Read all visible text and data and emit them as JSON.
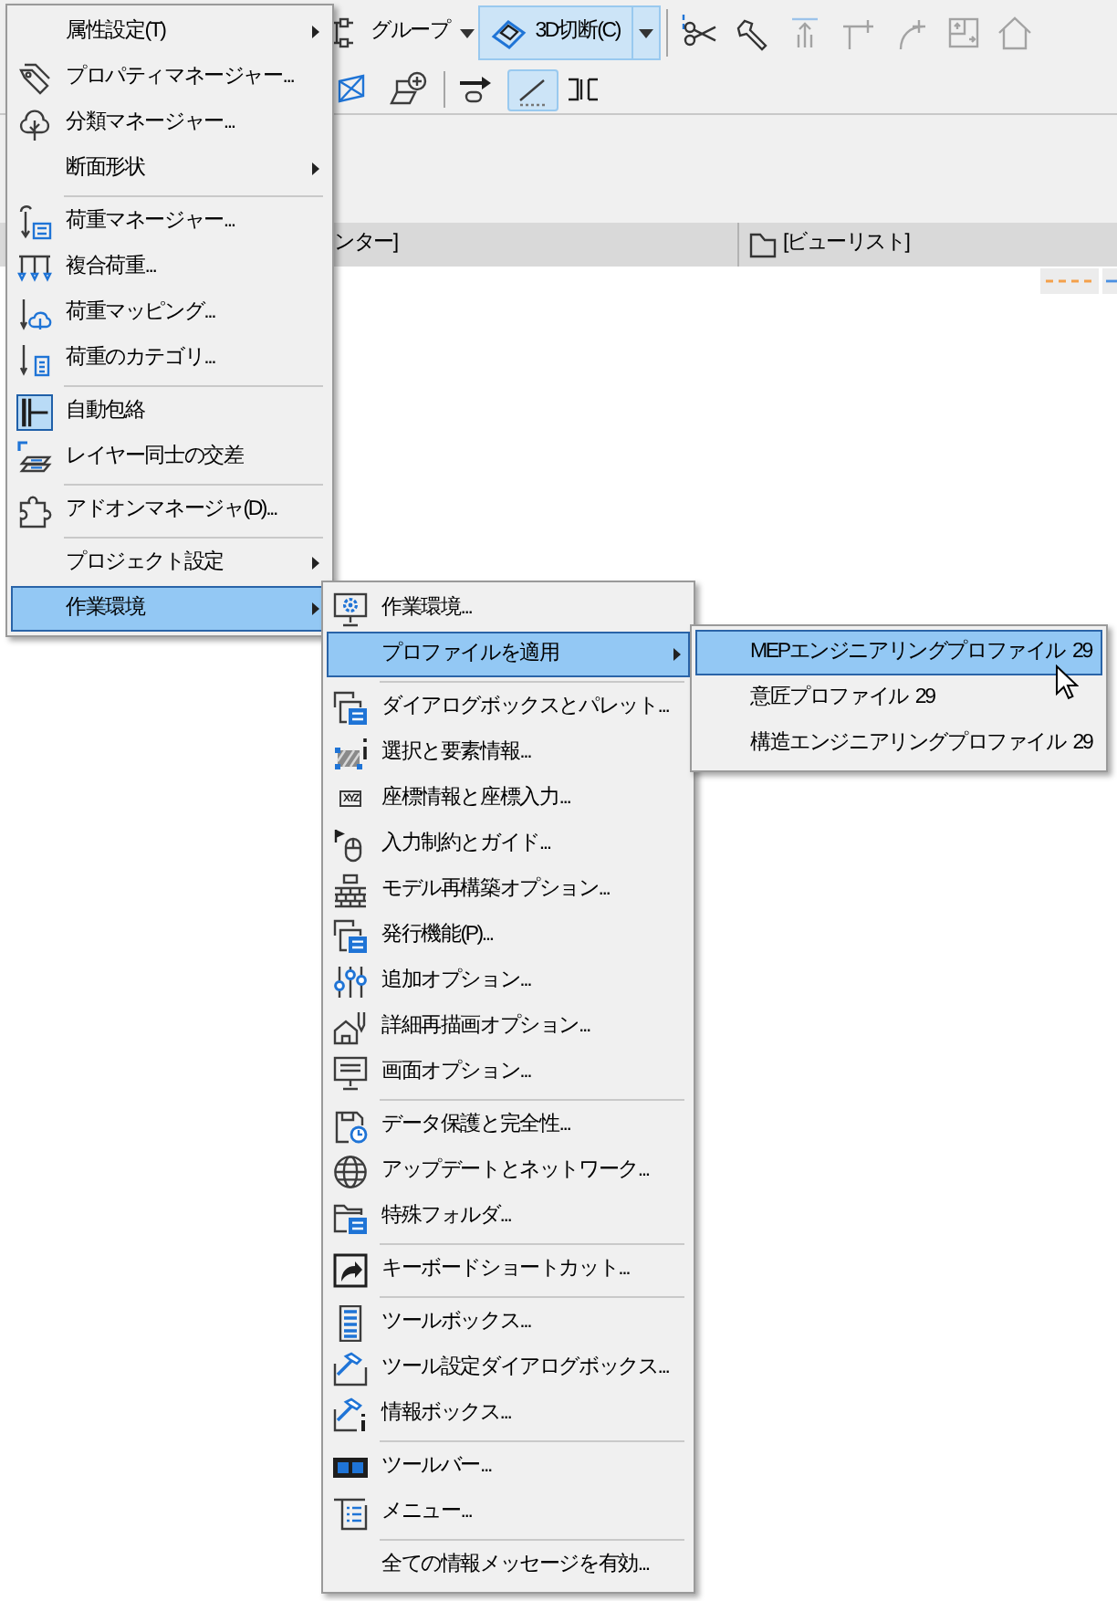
{
  "toolbar": {
    "row_1": [
      {
        "kind": "dropdown",
        "label": "グループ",
        "selected": false
      },
      {
        "kind": "split",
        "label": "3D切断(C)",
        "selected": true
      },
      {
        "kind": "separator"
      },
      {
        "kind": "icon",
        "disabled": false
      },
      {
        "kind": "icon",
        "disabled": false
      },
      {
        "kind": "icon",
        "disabled": true
      },
      {
        "kind": "icon",
        "disabled": true
      },
      {
        "kind": "icon",
        "disabled": true
      },
      {
        "kind": "icon",
        "disabled": true
      },
      {
        "kind": "icon",
        "disabled": true
      }
    ],
    "row_2": [
      {
        "kind": "icon",
        "selected": false
      },
      {
        "kind": "icon",
        "selected": false
      },
      {
        "kind": "separator"
      },
      {
        "kind": "icon",
        "selected": false
      },
      {
        "kind": "icon",
        "selected": true
      },
      {
        "kind": "icon",
        "selected": false
      }
    ]
  },
  "tab_bar": {
    "tabs": [
      {
        "label": "ンター]"
      },
      {
        "label": "[ビューリスト]"
      }
    ]
  },
  "menus": [
    {
      "items": [
        {
          "kind": "submenu",
          "label": "属性設定(T)",
          "selected": false,
          "checked": false
        },
        {
          "kind": "command",
          "label": "プロパティマネージャー...",
          "selected": false,
          "checked": false
        },
        {
          "kind": "command",
          "label": "分類マネージャー...",
          "selected": false,
          "checked": false
        },
        {
          "kind": "submenu",
          "label": "断面形状",
          "selected": false,
          "checked": false
        },
        {
          "kind": "separator"
        },
        {
          "kind": "command",
          "label": "荷重マネージャー...",
          "selected": false,
          "checked": false
        },
        {
          "kind": "command",
          "label": "複合荷重...",
          "selected": false,
          "checked": false
        },
        {
          "kind": "command",
          "label": "荷重マッピング...",
          "selected": false,
          "checked": false
        },
        {
          "kind": "command",
          "label": "荷重のカテゴリ...",
          "selected": false,
          "checked": false
        },
        {
          "kind": "separator"
        },
        {
          "kind": "command",
          "label": "自動包絡",
          "selected": false,
          "checked": true
        },
        {
          "kind": "command",
          "label": "レイヤー同士の交差",
          "selected": false,
          "checked": false
        },
        {
          "kind": "separator"
        },
        {
          "kind": "command",
          "label": "アドオンマネージャ(D)...",
          "selected": false,
          "checked": false
        },
        {
          "kind": "separator"
        },
        {
          "kind": "submenu",
          "label": "プロジェクト設定",
          "selected": false,
          "checked": false
        },
        {
          "kind": "submenu",
          "label": "作業環境",
          "selected": true,
          "checked": false
        }
      ]
    },
    {
      "items": [
        {
          "kind": "command",
          "label": "作業環境...",
          "selected": false
        },
        {
          "kind": "submenu",
          "label": "プロファイルを適用",
          "selected": true
        },
        {
          "kind": "separator"
        },
        {
          "kind": "command",
          "label": "ダイアログボックスとパレット...",
          "selected": false
        },
        {
          "kind": "command",
          "label": "選択と要素情報...",
          "selected": false
        },
        {
          "kind": "command",
          "label": "座標情報と座標入力...",
          "selected": false,
          "icon_label": "XYZ"
        },
        {
          "kind": "command",
          "label": "入力制約とガイド...",
          "selected": false
        },
        {
          "kind": "command",
          "label": "モデル再構築オプション...",
          "selected": false
        },
        {
          "kind": "command",
          "label": "発行機能(P)...",
          "selected": false
        },
        {
          "kind": "command",
          "label": "追加オプション...",
          "selected": false
        },
        {
          "kind": "command",
          "label": "詳細再描画オプション...",
          "selected": false
        },
        {
          "kind": "command",
          "label": "画面オプション...",
          "selected": false
        },
        {
          "kind": "separator"
        },
        {
          "kind": "command",
          "label": "データ保護と完全性...",
          "selected": false
        },
        {
          "kind": "command",
          "label": "アップデートとネットワーク...",
          "selected": false
        },
        {
          "kind": "command",
          "label": "特殊フォルダ...",
          "selected": false
        },
        {
          "kind": "separator"
        },
        {
          "kind": "command",
          "label": "キーボードショートカット...",
          "selected": false
        },
        {
          "kind": "separator"
        },
        {
          "kind": "command",
          "label": "ツールボックス...",
          "selected": false
        },
        {
          "kind": "command",
          "label": "ツール設定ダイアログボックス...",
          "selected": false
        },
        {
          "kind": "command",
          "label": "情報ボックス...",
          "selected": false
        },
        {
          "kind": "separator"
        },
        {
          "kind": "command",
          "label": "ツールバー...",
          "selected": false
        },
        {
          "kind": "command",
          "label": "メニュー...",
          "selected": false
        },
        {
          "kind": "separator"
        },
        {
          "kind": "command",
          "label": "全ての情報メッセージを有効...",
          "selected": false
        }
      ]
    },
    {
      "items": [
        {
          "kind": "command",
          "label": "MEPエンジニアリングプロファイル 29",
          "selected": true
        },
        {
          "kind": "command",
          "label": "意匠プロファイル 29",
          "selected": false
        },
        {
          "kind": "command",
          "label": "構造エンジニアリングプロファイル 29",
          "selected": false
        }
      ]
    }
  ]
}
